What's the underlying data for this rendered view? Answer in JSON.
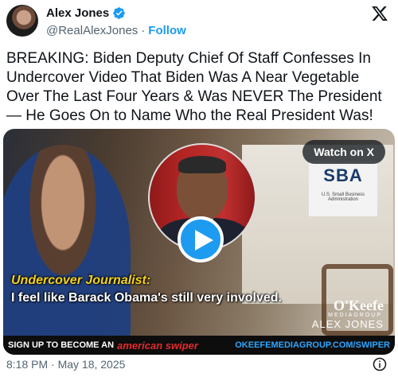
{
  "author": {
    "name": "Alex Jones",
    "handle": "@RealAlexJones",
    "separator": "·",
    "follow_label": "Follow",
    "verified_icon": "verified-badge-icon",
    "avatar_icon": "avatar"
  },
  "platform_icon": "x-logo-icon",
  "tweet_text": "BREAKING: Biden Deputy Chief Of Staff Confesses In Undercover Video That Biden Was A Near Vegetable Over The Last Four Years & Was NEVER The President— He Goes On to Name Who the Real President Was!",
  "media": {
    "watch_label": "Watch on X",
    "play_icon": "play-icon",
    "sba_logo": "SBA",
    "sba_sub": "U.S. Small Business Administration",
    "caption_title": "Undercover Journalist:",
    "caption_quote": "I feel like Barack Obama's still very involved.",
    "okeefe_brand": "O'Keefe",
    "okeefe_group": "MEDIAGROUP",
    "okeefe_alex": "ALEX JONES",
    "banner_left": "SIGN UP TO BECOME AN",
    "banner_mid": "american swiper",
    "banner_url": "OKEEFEMEDIAGROUP.COM/SWIPER"
  },
  "footer": {
    "timestamp": "8:18 PM · May 18, 2025",
    "info_icon": "info-icon"
  },
  "colors": {
    "accent": "#1d9bf0",
    "text": "#0f1419",
    "secondary": "#536471",
    "caption_yellow": "#f5d21b",
    "banner_red": "#e02b2b"
  }
}
